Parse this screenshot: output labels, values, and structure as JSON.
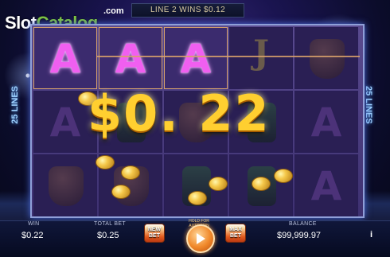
{
  "logo": {
    "text_main": "Slot",
    "text_accent": "Catalog",
    "text_com": ".com"
  },
  "topbar": {
    "text": "LINE 2 WINS $0.12"
  },
  "side_labels": {
    "left": "25 LINES",
    "right": "25 LINES"
  },
  "win_amount": "$0. 22",
  "reels": [
    [
      "A",
      "",
      ""
    ],
    [
      "A",
      "",
      ""
    ],
    [
      "A",
      "",
      ""
    ],
    [
      "J",
      "",
      ""
    ],
    [
      "",
      "",
      ""
    ]
  ],
  "bottom": {
    "win_label": "WIN",
    "win_value": "$0.22",
    "total_bet_label": "TOTAL BET",
    "total_bet_value": "$0.25",
    "new_bet_label": "NEW BET",
    "hold_label": "HOLD FOR AUTOSPIN",
    "max_bet_label": "MAX BET",
    "balance_label": "BALANCE",
    "balance_value": "$99,999.97",
    "info_label": "i"
  },
  "colors": {
    "accent": "#ffcf30",
    "symbol": "#f05ff0",
    "brand_green": "#7ec440"
  },
  "icons": {
    "spin": "play-icon",
    "info": "info-icon"
  }
}
